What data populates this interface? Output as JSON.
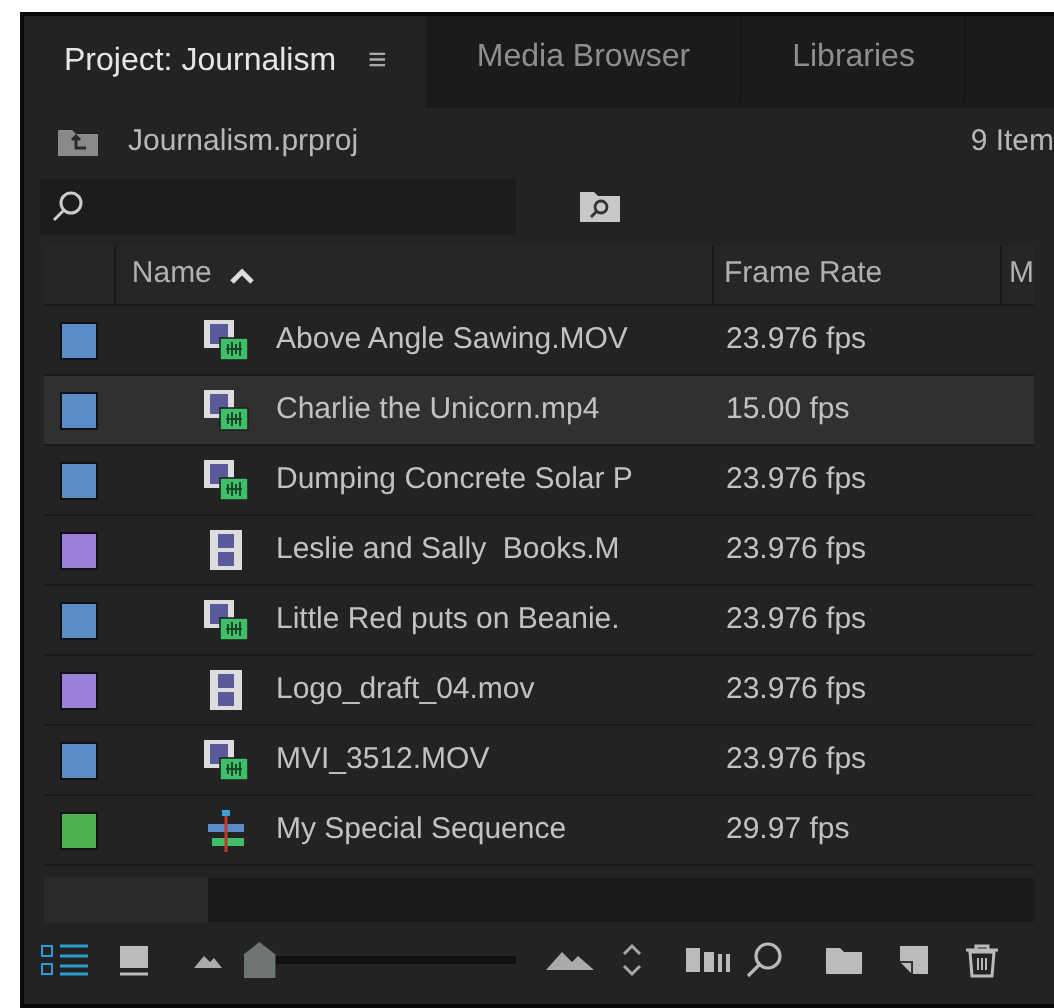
{
  "tabs": [
    {
      "label": "Project: Journalism",
      "selected": true,
      "menu": "≡"
    },
    {
      "label": "Media Browser",
      "selected": false
    },
    {
      "label": "Libraries",
      "selected": false
    }
  ],
  "path": {
    "file": "Journalism.prproj",
    "count": "9 Item"
  },
  "columns": [
    "Name",
    "Frame Rate",
    "M"
  ],
  "rows": [
    {
      "color": "#5b8cc7",
      "kind": "av",
      "name": "Above Angle Sawing.MOV",
      "frame_rate": "23.976 fps",
      "selected": false
    },
    {
      "color": "#5b8cc7",
      "kind": "av",
      "name": "Charlie the Unicorn.mp4",
      "frame_rate": "15.00 fps",
      "selected": true
    },
    {
      "color": "#5b8cc7",
      "kind": "av",
      "name": "Dumping Concrete Solar P",
      "frame_rate": "23.976 fps",
      "selected": false
    },
    {
      "color": "#9a80d8",
      "kind": "video",
      "name": "Leslie and Sally  Books.M",
      "frame_rate": "23.976 fps",
      "selected": false
    },
    {
      "color": "#5b8cc7",
      "kind": "av",
      "name": "Little Red puts on Beanie.",
      "frame_rate": "23.976 fps",
      "selected": false
    },
    {
      "color": "#9a80d8",
      "kind": "video",
      "name": "Logo_draft_04.mov",
      "frame_rate": "23.976 fps",
      "selected": false
    },
    {
      "color": "#5b8cc7",
      "kind": "av",
      "name": "MVI_3512.MOV",
      "frame_rate": "23.976 fps",
      "selected": false
    },
    {
      "color": "#4caf50",
      "kind": "sequence",
      "name": "My Special Sequence",
      "frame_rate": "29.97 fps",
      "selected": false
    }
  ],
  "zoom": {
    "level": 0.03
  }
}
